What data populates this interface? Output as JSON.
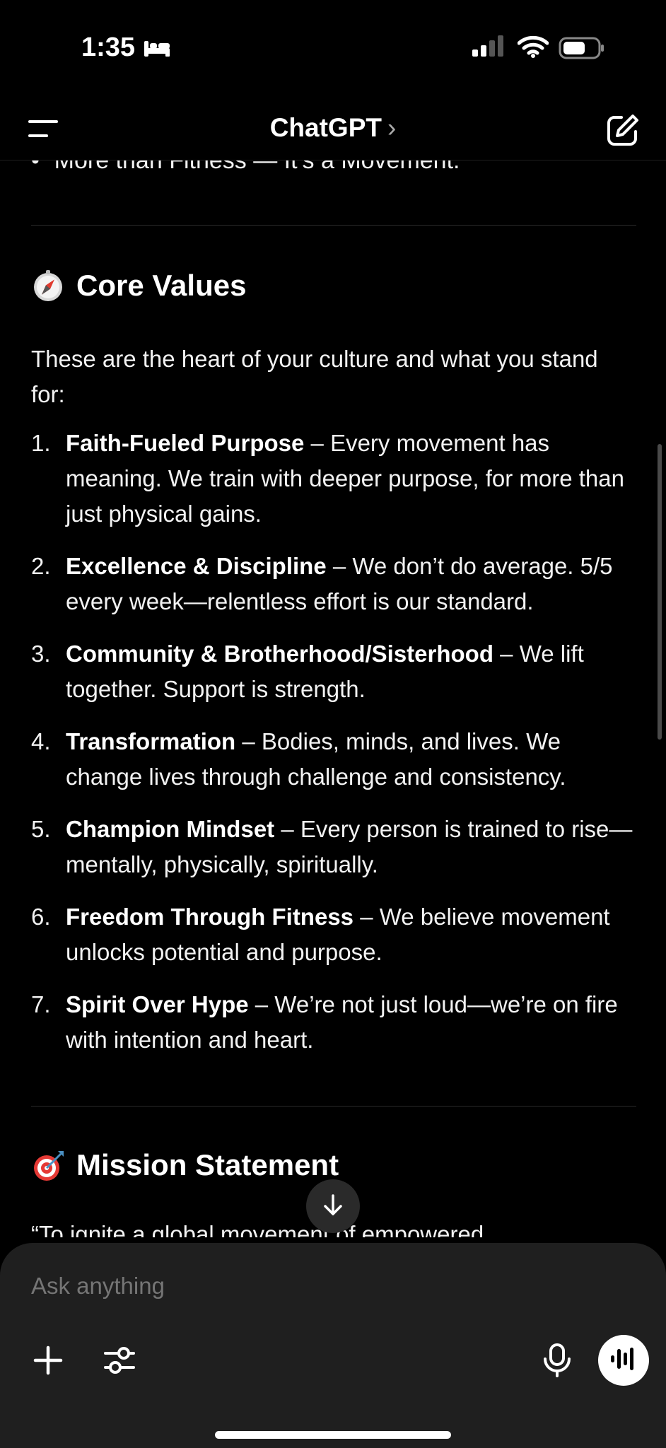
{
  "status_bar": {
    "time": "1:35",
    "icons": [
      "bed-icon",
      "signal-icon",
      "wifi-icon",
      "battery-icon"
    ]
  },
  "header": {
    "title": "ChatGPT",
    "chevron": "›",
    "icons": [
      "menu-icon",
      "new-chat-icon"
    ]
  },
  "content": {
    "partial_bullet": "• “More than Fitness — It’s a Movement.”",
    "core_values": {
      "heading": "Core Values",
      "icon": "compass-emoji-icon",
      "intro": "These are the heart of your culture and what you stand for:",
      "items": [
        {
          "num": "1.",
          "title": "Faith-Fueled Purpose",
          "text": " – Every movement has meaning. We train with deeper purpose, for more than just physical gains."
        },
        {
          "num": "2.",
          "title": "Excellence & Discipline",
          "text": " – We don’t do average. 5/5 every week—relentless effort is our standard."
        },
        {
          "num": "3.",
          "title": "Community & Brotherhood/Sisterhood",
          "text": " – We lift together. Support is strength."
        },
        {
          "num": "4.",
          "title": "Transformation",
          "text": " – Bodies, minds, and lives. We change lives through challenge and consistency."
        },
        {
          "num": "5.",
          "title": "Champion Mindset",
          "text": " – Every person is trained to rise—mentally, physically, spiritually."
        },
        {
          "num": "6.",
          "title": "Freedom Through Fitness",
          "text": " – We believe movement unlocks potential and purpose."
        },
        {
          "num": "7.",
          "title": "Spirit Over Hype",
          "text": " – We’re not just loud—we’re on fire with intention and heart."
        }
      ]
    },
    "mission": {
      "heading": "Mission Statement",
      "icon": "target-emoji-icon",
      "cut_text": "“To ignite a global movement of empowered"
    }
  },
  "composer": {
    "placeholder": "Ask anything",
    "icons": [
      "plus-icon",
      "tools-icon",
      "microphone-icon",
      "voice-mode-icon"
    ]
  },
  "colors": {
    "background": "#000000",
    "text": "#ffffff",
    "composer_bg": "#1f1f1f",
    "placeholder": "#8a8a8a"
  }
}
